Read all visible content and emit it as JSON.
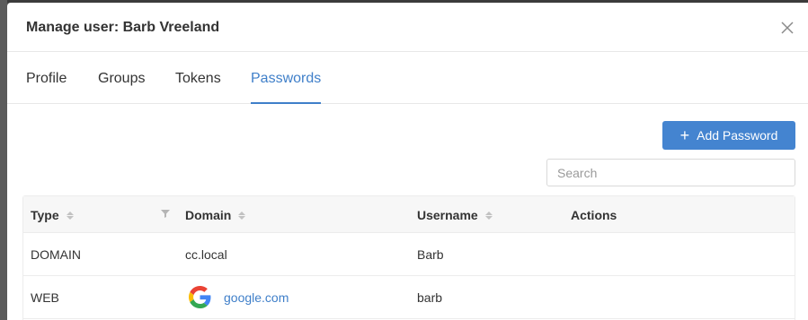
{
  "modal": {
    "title": "Manage user: Barb Vreeland"
  },
  "tabs": [
    {
      "label": "Profile",
      "active": false
    },
    {
      "label": "Groups",
      "active": false
    },
    {
      "label": "Tokens",
      "active": false
    },
    {
      "label": "Passwords",
      "active": true
    }
  ],
  "toolbar": {
    "add_label": "Add Password",
    "search_placeholder": "Search",
    "search_value": ""
  },
  "table": {
    "columns": [
      "Type",
      "Domain",
      "Username",
      "Actions"
    ],
    "rows": [
      {
        "type": "DOMAIN",
        "domain": "cc.local",
        "domain_icon": null,
        "username": "Barb"
      },
      {
        "type": "WEB",
        "domain": "google.com",
        "domain_icon": "google-icon",
        "username": "barb"
      }
    ]
  },
  "colors": {
    "accent": "#3f7fc9",
    "button": "#4484d0",
    "header_bg": "#f7f7f7"
  }
}
